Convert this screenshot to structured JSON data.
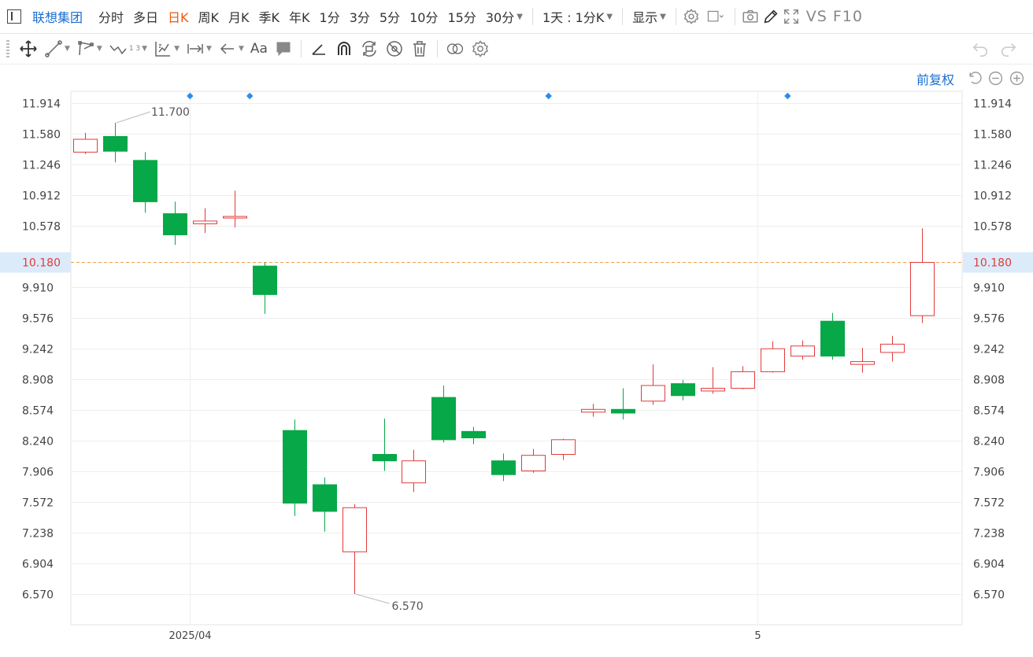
{
  "header": {
    "stock_name": "联想集团",
    "periods": [
      {
        "label": "分时",
        "active": false
      },
      {
        "label": "多日",
        "active": false
      },
      {
        "label": "日K",
        "active": true
      },
      {
        "label": "周K",
        "active": false
      },
      {
        "label": "月K",
        "active": false
      },
      {
        "label": "季K",
        "active": false
      },
      {
        "label": "年K",
        "active": false
      },
      {
        "label": "1分",
        "active": false
      },
      {
        "label": "3分",
        "active": false
      },
      {
        "label": "5分",
        "active": false
      },
      {
        "label": "10分",
        "active": false
      },
      {
        "label": "15分",
        "active": false
      }
    ],
    "period_dropdown": "30分",
    "multi_period": "1天 : 1分K",
    "display_label": "显示",
    "vs_f10": "VS F10"
  },
  "drawing_toolbar": {
    "text_tool": "Aa",
    "fib_badge": "1 3"
  },
  "chart_controls": {
    "adjust_label": "前复权"
  },
  "colors": {
    "up": "#e23b3b",
    "down": "#06a847",
    "accent": "#1a6fd1",
    "active_period": "#e85d10",
    "price_line": "#f0a04b",
    "price_highlight_bg": "#dcebfa"
  },
  "chart_data": {
    "type": "candlestick",
    "title": "",
    "y_ticks": [
      "11.914",
      "11.580",
      "11.246",
      "10.912",
      "10.578",
      "10.180",
      "9.910",
      "9.576",
      "9.242",
      "8.908",
      "8.574",
      "8.240",
      "7.906",
      "7.572",
      "7.238",
      "6.904",
      "6.570"
    ],
    "ylim": [
      6.4,
      12.07
    ],
    "x_labels": [
      {
        "index": 4,
        "label": "2025/04"
      },
      {
        "index": 23,
        "label": "5"
      }
    ],
    "current_price": "10.180",
    "high_annotation": {
      "index": 1,
      "value": 11.7,
      "label": "11.700"
    },
    "low_annotation": {
      "index": 9,
      "value": 6.57,
      "label": "6.570"
    },
    "event_markers": [
      4,
      6,
      16,
      24
    ],
    "candles": [
      {
        "o": 11.38,
        "h": 11.59,
        "l": 11.36,
        "c": 11.52
      },
      {
        "o": 11.55,
        "h": 11.7,
        "l": 11.27,
        "c": 11.39
      },
      {
        "o": 11.29,
        "h": 11.38,
        "l": 10.72,
        "c": 10.84
      },
      {
        "o": 10.71,
        "h": 10.84,
        "l": 10.37,
        "c": 10.48
      },
      {
        "o": 10.6,
        "h": 10.77,
        "l": 10.5,
        "c": 10.63
      },
      {
        "o": 10.67,
        "h": 10.96,
        "l": 10.56,
        "c": 10.68
      },
      {
        "o": 10.14,
        "h": 10.18,
        "l": 9.62,
        "c": 9.83
      },
      {
        "o": 8.35,
        "h": 8.47,
        "l": 7.42,
        "c": 7.56
      },
      {
        "o": 7.76,
        "h": 7.84,
        "l": 7.25,
        "c": 7.47
      },
      {
        "o": 7.03,
        "h": 7.55,
        "l": 6.57,
        "c": 7.51
      },
      {
        "o": 8.09,
        "h": 8.48,
        "l": 7.91,
        "c": 8.02
      },
      {
        "o": 7.78,
        "h": 8.14,
        "l": 7.68,
        "c": 8.02
      },
      {
        "o": 8.71,
        "h": 8.84,
        "l": 8.22,
        "c": 8.25
      },
      {
        "o": 8.34,
        "h": 8.39,
        "l": 8.2,
        "c": 8.27
      },
      {
        "o": 8.02,
        "h": 8.1,
        "l": 7.8,
        "c": 7.87
      },
      {
        "o": 7.91,
        "h": 8.15,
        "l": 7.89,
        "c": 8.08
      },
      {
        "o": 8.09,
        "h": 8.26,
        "l": 8.03,
        "c": 8.25
      },
      {
        "o": 8.55,
        "h": 8.64,
        "l": 8.5,
        "c": 8.58
      },
      {
        "o": 8.58,
        "h": 8.81,
        "l": 8.47,
        "c": 8.54
      },
      {
        "o": 8.67,
        "h": 9.07,
        "l": 8.63,
        "c": 8.84
      },
      {
        "o": 8.86,
        "h": 8.9,
        "l": 8.68,
        "c": 8.73
      },
      {
        "o": 8.78,
        "h": 9.04,
        "l": 8.75,
        "c": 8.81
      },
      {
        "o": 8.81,
        "h": 9.05,
        "l": 8.8,
        "c": 8.99
      },
      {
        "o": 8.99,
        "h": 9.32,
        "l": 8.98,
        "c": 9.24
      },
      {
        "o": 9.16,
        "h": 9.33,
        "l": 9.12,
        "c": 9.27
      },
      {
        "o": 9.54,
        "h": 9.63,
        "l": 9.12,
        "c": 9.16
      },
      {
        "o": 9.07,
        "h": 9.25,
        "l": 8.98,
        "c": 9.1
      },
      {
        "o": 9.2,
        "h": 9.38,
        "l": 9.1,
        "c": 9.29
      },
      {
        "o": 9.6,
        "h": 10.55,
        "l": 9.52,
        "c": 10.18
      }
    ]
  }
}
